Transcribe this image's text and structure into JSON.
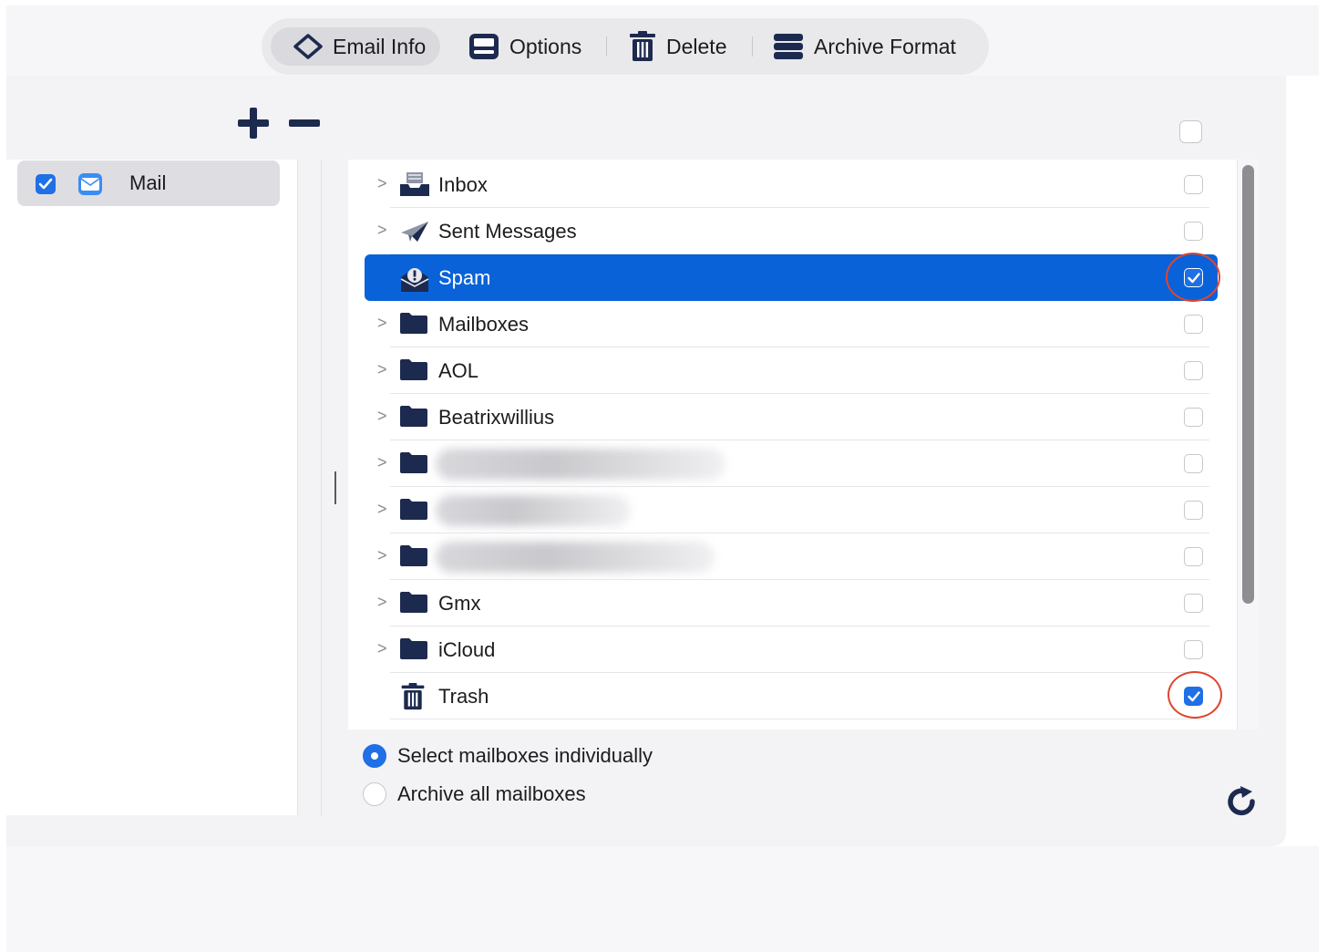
{
  "toolbar": {
    "email_info_label": "Email Info",
    "options_label": "Options",
    "delete_label": "Delete",
    "archive_format_label": "Archive Format"
  },
  "sidebar": {
    "items": [
      {
        "label": "Mail",
        "checked": true,
        "icon": "mail-app-icon"
      }
    ]
  },
  "mailboxes": [
    {
      "label": "Inbox",
      "icon": "inbox-tray-icon",
      "expandable": true,
      "checked": false
    },
    {
      "label": "Sent Messages",
      "icon": "paper-plane-icon",
      "expandable": true,
      "checked": false
    },
    {
      "label": "Spam",
      "icon": "spam-envelope-icon",
      "expandable": false,
      "checked": true,
      "selected": true
    },
    {
      "label": "Mailboxes",
      "icon": "folder-icon",
      "expandable": true,
      "checked": false
    },
    {
      "label": "AOL",
      "icon": "folder-icon",
      "expandable": true,
      "checked": false
    },
    {
      "label": "Beatrixwillius",
      "icon": "folder-icon",
      "expandable": true,
      "checked": false
    },
    {
      "label": "",
      "icon": "folder-icon",
      "expandable": true,
      "checked": false,
      "blurred": true
    },
    {
      "label": "",
      "icon": "folder-icon",
      "expandable": true,
      "checked": false,
      "blurred": true
    },
    {
      "label": "",
      "icon": "folder-icon",
      "expandable": true,
      "checked": false,
      "blurred": true
    },
    {
      "label": "Gmx",
      "icon": "folder-icon",
      "expandable": true,
      "checked": false
    },
    {
      "label": "iCloud",
      "icon": "folder-icon",
      "expandable": true,
      "checked": false
    },
    {
      "label": "Trash",
      "icon": "trash-icon",
      "expandable": false,
      "checked": true
    }
  ],
  "options": {
    "select_individually_label": "Select mailboxes individually",
    "archive_all_label": "Archive all mailboxes",
    "selected": "select_individually"
  },
  "colors": {
    "accent": "#1f6fe6",
    "selection": "#0a62d9",
    "annotation_circle": "#e0452f",
    "icon_navy": "#1d2a4f"
  }
}
